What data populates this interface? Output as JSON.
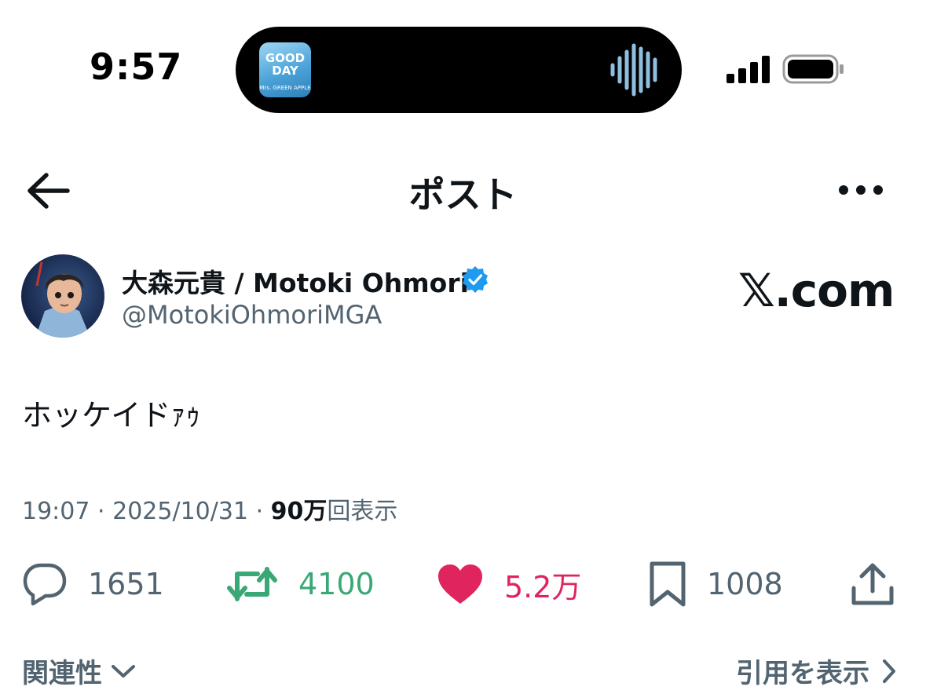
{
  "status_bar": {
    "time": "9:57",
    "now_playing_art": {
      "line1": "GOOD",
      "line2": "DAY",
      "line3": "Mrs. GREEN APPLE"
    }
  },
  "header": {
    "title": "ポスト"
  },
  "author": {
    "display_name": "大森元貴 / Motoki Ohmori",
    "handle": "@MotokiOhmoriMGA",
    "verified": true
  },
  "watermark": {
    "text": "𝕏.com"
  },
  "post": {
    "text": "ホッケイドｧｩ",
    "time": "19:07",
    "separator": "·",
    "date": "2025/10/31",
    "views_count": "90万",
    "views_label": "回表示"
  },
  "actions": {
    "replies": "1651",
    "reposts": "4100",
    "likes": "5.2万",
    "bookmarks": "1008"
  },
  "footer": {
    "sort_label": "関連性",
    "quotes_label": "引用を表示"
  },
  "colors": {
    "text_primary": "#0f1419",
    "text_secondary": "#536471",
    "repost_green": "#3aa876",
    "like_pink": "#e0245e",
    "verified_blue": "#1d9bf0"
  }
}
